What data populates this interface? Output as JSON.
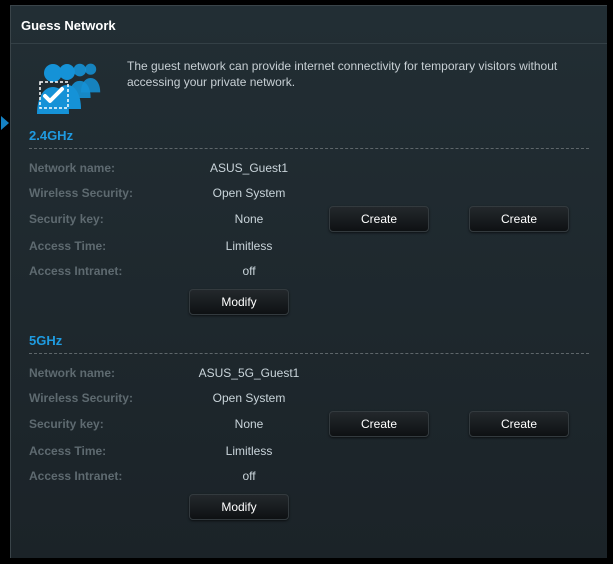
{
  "title": "Guess Network",
  "intro": "The guest network can provide internet connectivity for temporary visitors without accessing your private network.",
  "labels": {
    "network_name": "Network name:",
    "wireless_security": "Wireless Security:",
    "security_key": "Security key:",
    "access_time": "Access Time:",
    "access_intranet": "Access Intranet:"
  },
  "buttons": {
    "create": "Create",
    "modify": "Modify"
  },
  "bands": {
    "b24": {
      "title": "2.4GHz",
      "network_name": "ASUS_Guest1",
      "wireless_security": "Open System",
      "security_key": "None",
      "access_time": "Limitless",
      "access_intranet": "off"
    },
    "b5": {
      "title": "5GHz",
      "network_name": "ASUS_5G_Guest1",
      "wireless_security": "Open System",
      "security_key": "None",
      "access_time": "Limitless",
      "access_intranet": "off"
    }
  }
}
